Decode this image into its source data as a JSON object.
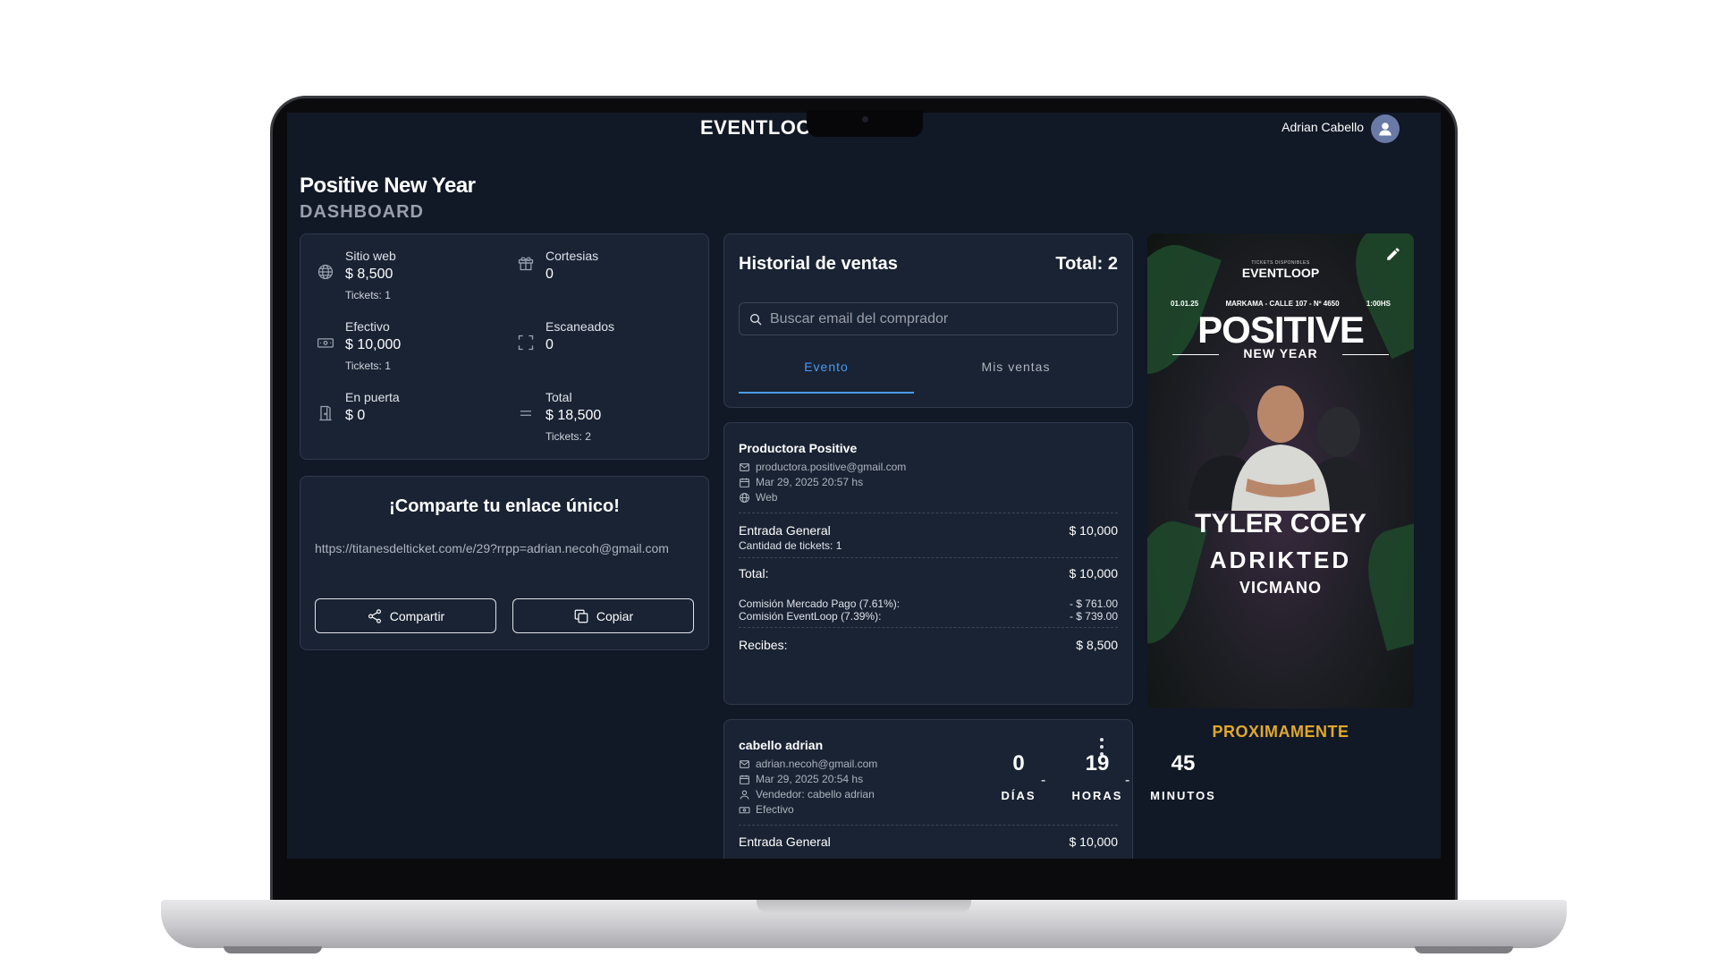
{
  "app": {
    "brand": "EVENTLOOP",
    "user_name": "Adrian Cabello"
  },
  "page": {
    "title": "Positive New Year",
    "subtitle": "DASHBOARD"
  },
  "stats": [
    {
      "label": "Sitio web",
      "value": "$ 8,500",
      "sub": "Tickets: 1",
      "icon": "globe-icon"
    },
    {
      "label": "Cortesias",
      "value": "0",
      "sub": "",
      "icon": "gift-icon"
    },
    {
      "label": "Efectivo",
      "value": "$ 10,000",
      "sub": "Tickets: 1",
      "icon": "cash-icon"
    },
    {
      "label": "Escaneados",
      "value": "0",
      "sub": "",
      "icon": "scan-icon"
    },
    {
      "label": "En puerta",
      "value": "$ 0",
      "sub": "",
      "icon": "door-icon"
    },
    {
      "label": "Total",
      "value": "$ 18,500",
      "sub": "Tickets: 2",
      "icon": "equals-icon"
    }
  ],
  "share": {
    "title": "¡Comparte tu enlace único!",
    "url": "https://titanesdelticket.com/e/29?rrpp=adrian.necoh@gmail.com",
    "share_label": "Compartir",
    "copy_label": "Copiar"
  },
  "sales": {
    "title": "Historial de ventas",
    "total": "Total: 2",
    "search_placeholder": "Buscar email del comprador",
    "tabs": [
      "Evento",
      "Mis ventas"
    ],
    "items": [
      {
        "name": "Productora Positive",
        "email": "productora.positive@gmail.com",
        "date": "Mar 29, 2025 20:57 hs",
        "channel": "Web",
        "ticket_type": "Entrada General",
        "ticket_price": "$ 10,000",
        "ticket_qty": "Cantidad de tickets: 1",
        "total_label": "Total:",
        "total_value": "$ 10,000",
        "fee1_label": "Comisión Mercado Pago (7.61%):",
        "fee1_value": "- $ 761.00",
        "fee2_label": "Comisión EventLoop (7.39%):",
        "fee2_value": "- $ 739.00",
        "receive_label": "Recibes:",
        "receive_value": "$ 8,500"
      },
      {
        "name": "cabello adrian",
        "email": "adrian.necoh@gmail.com",
        "date": "Mar 29, 2025 20:54 hs",
        "seller": "Vendedor: cabello adrian",
        "channel": "Efectivo",
        "ticket_type": "Entrada General",
        "ticket_price": "$ 10,000"
      }
    ]
  },
  "poster": {
    "brand_top": "TICKETS DISPONIBLES",
    "brand": "EVENTLOOP",
    "date": "01.01.25",
    "venue": "MARKAMA - CALLE 107 - Nº 4650",
    "time": "1:00HS",
    "title": "POSITIVE",
    "subtitle": "NEW YEAR",
    "artists": [
      "TYLER COEY",
      "ADRIKTED",
      "VICMANO"
    ]
  },
  "countdown": {
    "heading": "PROXIMAMENTE",
    "days": "0",
    "days_label": "DÍAS",
    "hours": "19",
    "hours_label": "HORAS",
    "minutes": "45",
    "minutes_label": "MINUTOS",
    "separator": "-"
  },
  "colors": {
    "background": "#111826",
    "card": "#1a2333",
    "accent": "#4a9bf0",
    "warning": "#e0a82e"
  }
}
